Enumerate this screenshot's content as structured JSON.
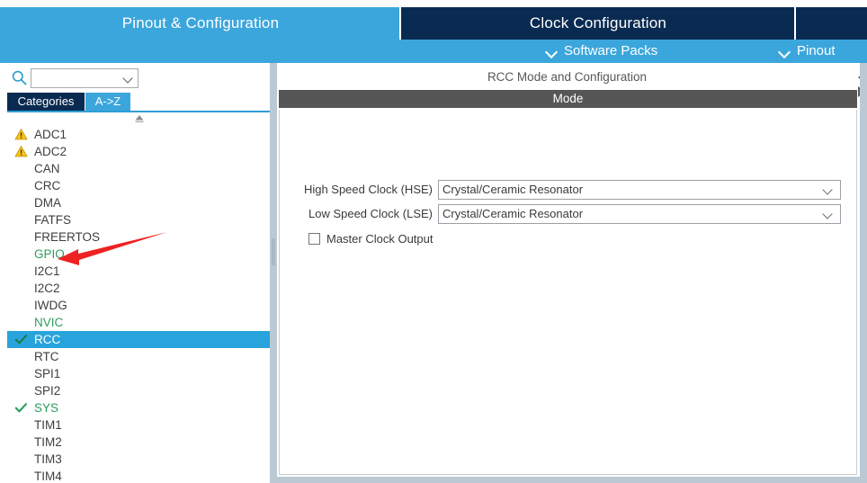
{
  "window": {
    "tabs": [
      {
        "label": "Pinout & Configuration",
        "active": false
      },
      {
        "label": "Clock Configuration",
        "active": true
      },
      {
        "label": "",
        "active": true
      }
    ]
  },
  "subbar": {
    "software_packs": "Software Packs",
    "pinout": "Pinout"
  },
  "sidebar": {
    "search": {
      "value": "",
      "placeholder": ""
    },
    "search_icon": "search-icon",
    "gear_icon": "gear-icon",
    "view_tabs": [
      {
        "label": "Categories",
        "active": true
      },
      {
        "label": "A->Z",
        "active": false
      }
    ],
    "items": [
      {
        "label": "ADC1",
        "mark": "warning",
        "state": "normal"
      },
      {
        "label": "ADC2",
        "mark": "warning",
        "state": "normal"
      },
      {
        "label": "CAN",
        "mark": "none",
        "state": "normal"
      },
      {
        "label": "CRC",
        "mark": "none",
        "state": "normal"
      },
      {
        "label": "DMA",
        "mark": "none",
        "state": "normal"
      },
      {
        "label": "FATFS",
        "mark": "none",
        "state": "normal"
      },
      {
        "label": "FREERTOS",
        "mark": "none",
        "state": "normal"
      },
      {
        "label": "GPIO",
        "mark": "none",
        "state": "configured"
      },
      {
        "label": "I2C1",
        "mark": "none",
        "state": "normal"
      },
      {
        "label": "I2C2",
        "mark": "none",
        "state": "normal"
      },
      {
        "label": "IWDG",
        "mark": "none",
        "state": "normal"
      },
      {
        "label": "NVIC",
        "mark": "none",
        "state": "configured"
      },
      {
        "label": "RCC",
        "mark": "check",
        "state": "selected"
      },
      {
        "label": "RTC",
        "mark": "none",
        "state": "normal"
      },
      {
        "label": "SPI1",
        "mark": "none",
        "state": "normal"
      },
      {
        "label": "SPI2",
        "mark": "none",
        "state": "normal"
      },
      {
        "label": "SYS",
        "mark": "check",
        "state": "configured"
      },
      {
        "label": "TIM1",
        "mark": "none",
        "state": "normal"
      },
      {
        "label": "TIM2",
        "mark": "none",
        "state": "normal"
      },
      {
        "label": "TIM3",
        "mark": "none",
        "state": "normal"
      },
      {
        "label": "TIM4",
        "mark": "none",
        "state": "normal"
      }
    ]
  },
  "main": {
    "title": "RCC Mode and Configuration",
    "mode_header": "Mode",
    "fields": [
      {
        "label": "High Speed Clock (HSE)",
        "value": "Crystal/Ceramic Resonator"
      },
      {
        "label": "Low Speed Clock (LSE)",
        "value": "Crystal/Ceramic Resonator"
      }
    ],
    "checkbox": {
      "label": "Master Clock Output",
      "checked": false
    }
  },
  "annotation": {
    "type": "red-arrow",
    "points_to": "GPIO",
    "color": "#ee2222"
  },
  "colors": {
    "accent_blue": "#3ba6dc",
    "dark_navy": "#0a2b51",
    "selected_row": "#29a3db",
    "mode_bar": "#565656",
    "configured_green": "#2c9c5e",
    "warning_yellow": "#f5c518"
  }
}
